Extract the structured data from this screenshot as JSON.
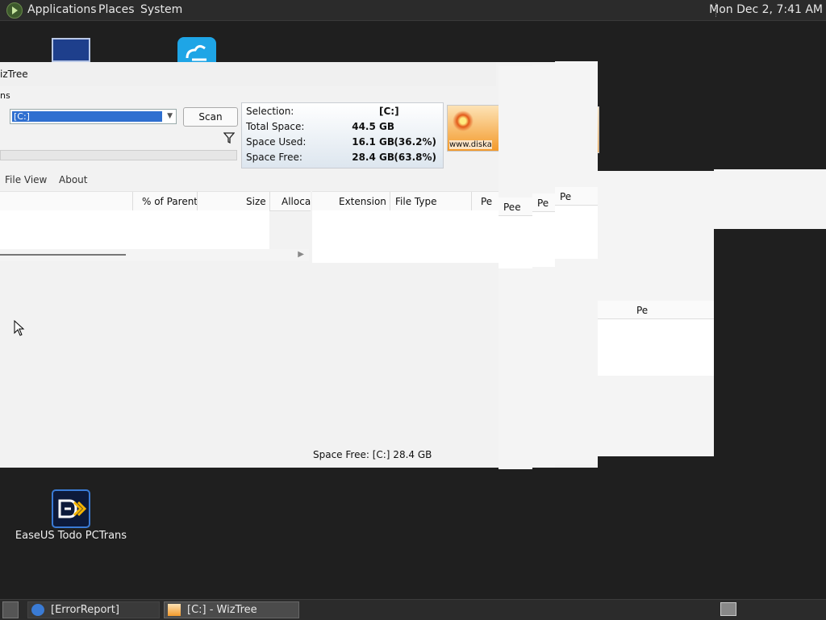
{
  "panel": {
    "applications": "Applications",
    "places": "Places",
    "system": "System",
    "clock": "Mon Dec 2,  7:41 AM"
  },
  "desktop": {
    "pctrans_label": "EaseUS Todo PCTrans"
  },
  "wiztree": {
    "title": "izTree",
    "menu_fragment": "ns",
    "drive_value": "[C:]",
    "scan_label": "Scan",
    "summary": {
      "selection_label": "Selection:",
      "selection_value": "[C:]",
      "total_label": "Total Space:",
      "total_value": "44.5 GB",
      "used_label": "Space Used:",
      "used_value": "16.1 GB",
      "used_pct": "(36.2%)",
      "free_label": "Space Free:",
      "free_value": "28.4 GB",
      "free_pct": "(63.8%)"
    },
    "logo_watermark": "www.diska",
    "menubar": {
      "file_view": "File View",
      "about": "About"
    },
    "tree_columns": [
      "% of Parent",
      "Size",
      "Alloca"
    ],
    "ext_columns": [
      "Extension",
      "File Type",
      "Pe"
    ],
    "glitch_header": "Pee",
    "glitch_header_alt": "Pe",
    "status": "Space Free: [C:] 28.4 GB"
  },
  "taskbar": {
    "error_report": "[ErrorReport]",
    "wiztree": "[C:]  - WizTree"
  },
  "colors": {
    "panel_bg": "#2b2b2b",
    "desktop_bg": "#1f1f1f",
    "selection_blue": "#2f6fd0",
    "logo_orange": "#f39a2b"
  }
}
